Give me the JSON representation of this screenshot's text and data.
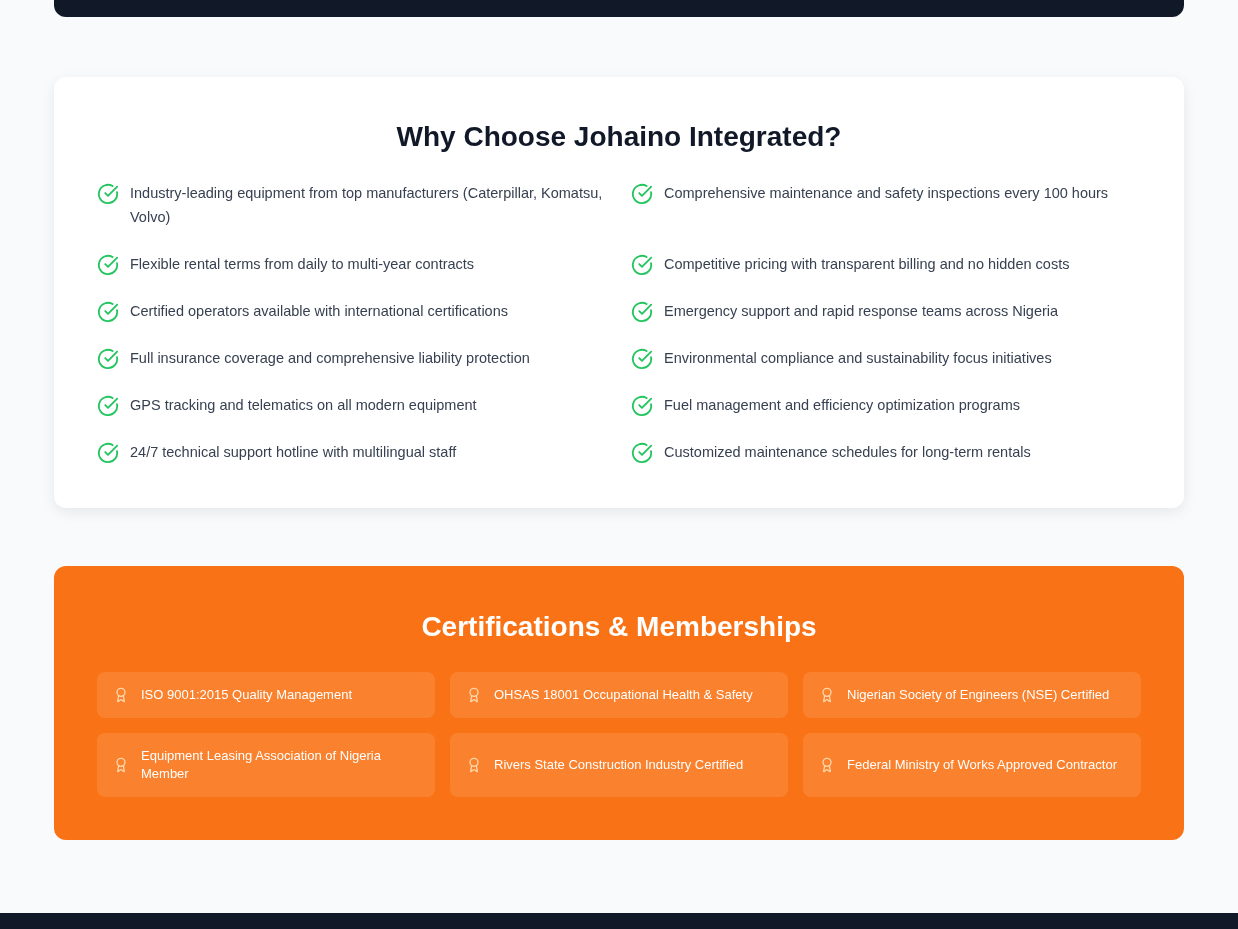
{
  "why_choose": {
    "title": "Why Choose Johaino Integrated?",
    "features": [
      "Industry-leading equipment from top manufacturers (Caterpillar, Komatsu, Volvo)",
      "Comprehensive maintenance and safety inspections every 100 hours",
      "Flexible rental terms from daily to multi-year contracts",
      "Competitive pricing with transparent billing and no hidden costs",
      "Certified operators available with international certifications",
      "Emergency support and rapid response teams across Nigeria",
      "Full insurance coverage and comprehensive liability protection",
      "Environmental compliance and sustainability focus initiatives",
      "GPS tracking and telematics on all modern equipment",
      "Fuel management and efficiency optimization programs",
      "24/7 technical support hotline with multilingual staff",
      "Customized maintenance schedules for long-term rentals"
    ]
  },
  "certifications": {
    "title": "Certifications & Memberships",
    "items": [
      "ISO 9001:2015 Quality Management",
      "OHSAS 18001 Occupational Health & Safety",
      "Nigerian Society of Engineers (NSE) Certified",
      "Equipment Leasing Association of Nigeria Member",
      "Rivers State Construction Industry Certified",
      "Federal Ministry of Works Approved Contractor"
    ]
  }
}
